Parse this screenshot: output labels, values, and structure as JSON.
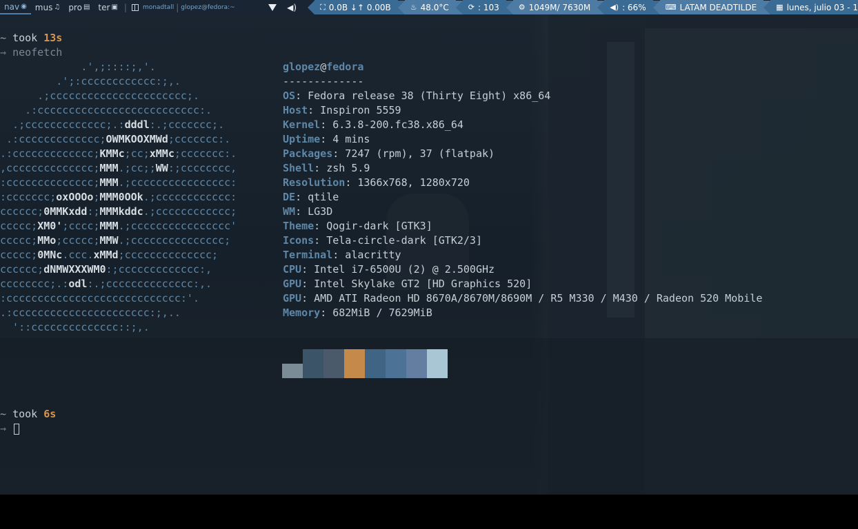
{
  "bar": {
    "workspaces": [
      {
        "label": "nav",
        "icon": "firefox-icon",
        "glyph": "◉",
        "active": true
      },
      {
        "label": "mus",
        "icon": "music-icon",
        "glyph": "♫",
        "active": false
      },
      {
        "label": "pro",
        "icon": "document-icon",
        "glyph": "▤",
        "active": false
      },
      {
        "label": "ter",
        "icon": "terminal-icon",
        "glyph": "▣",
        "active": false
      }
    ],
    "layout_name": "monadtall",
    "window_title": "glopez@fedora:~",
    "net": "0.0B ↓↑  0.00B",
    "temp": "48.0°C",
    "updates": ": 103",
    "memory": "1049M/ 7630M",
    "volume": ": 66%",
    "keyboard": "LATAM DEADTILDE",
    "clock": "lunes, julio 03 - 1"
  },
  "term": {
    "prompt1": {
      "tilde": "~",
      "took": "took",
      "dur": "13s"
    },
    "command": "neofetch",
    "prompt2": {
      "tilde": "~",
      "took": "took",
      "dur": "6s"
    },
    "arrow": "→",
    "art": [
      "             .',;::::;,'.",
      "         .';:cccccccccccc:;,.",
      "      .;cccccccccccccccccccccc;.",
      "    .:cccccccccccccccccccccccccc:.",
      "  .;ccccccccccccc;.:dddl:.;ccccccc;.",
      " .:ccccccccccccc;OWMKOOXMWd;ccccccc:.",
      ".:ccccccccccccc;KMMc;cc;xMMc;ccccccc:.",
      ",cccccccccccccc;MMM.;cc;;WW:;cccccccc,",
      ":cccccccccccccc;MMM.;cccccccccccccccc:",
      ":ccccccc;oxOOOo;MMM0OOk.;cccccccccccc:",
      "cccccc;0MMKxdd:;MMMkddc.;cccccccccccc;",
      "ccccc;XM0';cccc;MMM.;cccccccccccccccc'",
      "ccccc;MMo;ccccc;MMW.;ccccccccccccccc;",
      "ccccc;0MNc.ccc.xMMd;cccccccccccccc;",
      "cccccc;dNMWXXXWM0:;ccccccccccccc:,",
      "cccccccc;.:odl:.;cccccccccccccc:,.",
      ":cccccccccccccccccccccccccccc:'.",
      ".:cccccccccccccccccccccc:;,..",
      "  '::cccccccccccccc::;,."
    ],
    "info": {
      "user": "glopez",
      "at": "@",
      "host": "fedora",
      "separator": "-------------",
      "rows": [
        {
          "k": "OS",
          "v": ": Fedora release 38 (Thirty Eight) x86_64"
        },
        {
          "k": "Host",
          "v": ": Inspiron 5559"
        },
        {
          "k": "Kernel",
          "v": ": 6.3.8-200.fc38.x86_64"
        },
        {
          "k": "Uptime",
          "v": ": 4 mins"
        },
        {
          "k": "Packages",
          "v": ": 7247 (rpm), 37 (flatpak)"
        },
        {
          "k": "Shell",
          "v": ": zsh 5.9"
        },
        {
          "k": "Resolution",
          "v": ": 1366x768, 1280x720"
        },
        {
          "k": "DE",
          "v": ": qtile"
        },
        {
          "k": "WM",
          "v": ": LG3D"
        },
        {
          "k": "Theme",
          "v": ": Qogir-dark [GTK3]"
        },
        {
          "k": "Icons",
          "v": ": Tela-circle-dark [GTK2/3]"
        },
        {
          "k": "Terminal",
          "v": ": alacritty"
        },
        {
          "k": "CPU",
          "v": ": Intel i7-6500U (2) @ 2.500GHz"
        },
        {
          "k": "GPU",
          "v": ": Intel Skylake GT2 [HD Graphics 520]"
        },
        {
          "k": "GPU",
          "v": ": AMD ATI Radeon HD 8670A/8670M/8690M / R5 M330 / M430 / Radeon 520 Mobile"
        },
        {
          "k": "Memory",
          "v": ": 682MiB / 7629MiB"
        }
      ]
    },
    "palette": [
      "#7b8c96",
      "#3c5468",
      "#4a5a6a",
      "#c58a4a",
      "#3f6484",
      "#4c7396",
      "#637ea0",
      "#a8c6d4"
    ]
  }
}
